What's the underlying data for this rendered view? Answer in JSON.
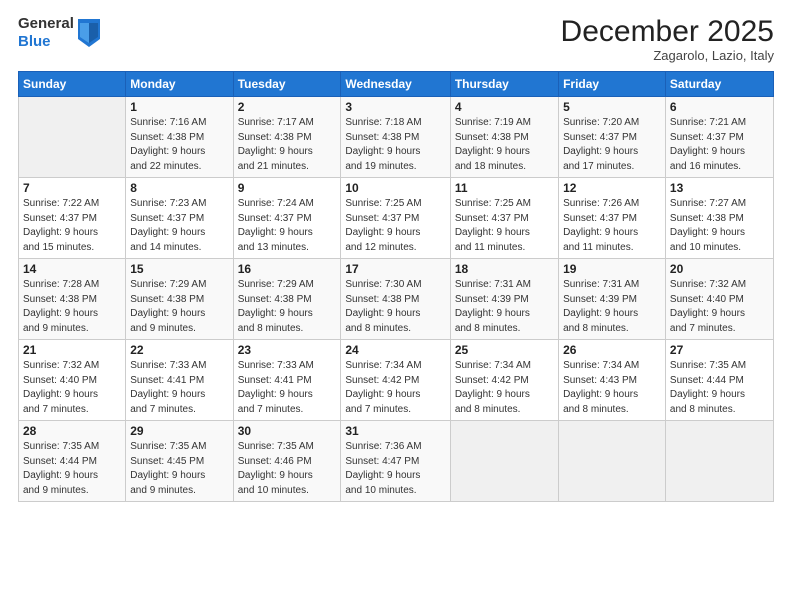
{
  "header": {
    "logo_line1": "General",
    "logo_line2": "Blue",
    "month": "December 2025",
    "location": "Zagarolo, Lazio, Italy"
  },
  "weekdays": [
    "Sunday",
    "Monday",
    "Tuesday",
    "Wednesday",
    "Thursday",
    "Friday",
    "Saturday"
  ],
  "weeks": [
    [
      {
        "day": "",
        "info": ""
      },
      {
        "day": "1",
        "info": "Sunrise: 7:16 AM\nSunset: 4:38 PM\nDaylight: 9 hours\nand 22 minutes."
      },
      {
        "day": "2",
        "info": "Sunrise: 7:17 AM\nSunset: 4:38 PM\nDaylight: 9 hours\nand 21 minutes."
      },
      {
        "day": "3",
        "info": "Sunrise: 7:18 AM\nSunset: 4:38 PM\nDaylight: 9 hours\nand 19 minutes."
      },
      {
        "day": "4",
        "info": "Sunrise: 7:19 AM\nSunset: 4:38 PM\nDaylight: 9 hours\nand 18 minutes."
      },
      {
        "day": "5",
        "info": "Sunrise: 7:20 AM\nSunset: 4:37 PM\nDaylight: 9 hours\nand 17 minutes."
      },
      {
        "day": "6",
        "info": "Sunrise: 7:21 AM\nSunset: 4:37 PM\nDaylight: 9 hours\nand 16 minutes."
      }
    ],
    [
      {
        "day": "7",
        "info": "Sunrise: 7:22 AM\nSunset: 4:37 PM\nDaylight: 9 hours\nand 15 minutes."
      },
      {
        "day": "8",
        "info": "Sunrise: 7:23 AM\nSunset: 4:37 PM\nDaylight: 9 hours\nand 14 minutes."
      },
      {
        "day": "9",
        "info": "Sunrise: 7:24 AM\nSunset: 4:37 PM\nDaylight: 9 hours\nand 13 minutes."
      },
      {
        "day": "10",
        "info": "Sunrise: 7:25 AM\nSunset: 4:37 PM\nDaylight: 9 hours\nand 12 minutes."
      },
      {
        "day": "11",
        "info": "Sunrise: 7:25 AM\nSunset: 4:37 PM\nDaylight: 9 hours\nand 11 minutes."
      },
      {
        "day": "12",
        "info": "Sunrise: 7:26 AM\nSunset: 4:37 PM\nDaylight: 9 hours\nand 11 minutes."
      },
      {
        "day": "13",
        "info": "Sunrise: 7:27 AM\nSunset: 4:38 PM\nDaylight: 9 hours\nand 10 minutes."
      }
    ],
    [
      {
        "day": "14",
        "info": "Sunrise: 7:28 AM\nSunset: 4:38 PM\nDaylight: 9 hours\nand 9 minutes."
      },
      {
        "day": "15",
        "info": "Sunrise: 7:29 AM\nSunset: 4:38 PM\nDaylight: 9 hours\nand 9 minutes."
      },
      {
        "day": "16",
        "info": "Sunrise: 7:29 AM\nSunset: 4:38 PM\nDaylight: 9 hours\nand 8 minutes."
      },
      {
        "day": "17",
        "info": "Sunrise: 7:30 AM\nSunset: 4:38 PM\nDaylight: 9 hours\nand 8 minutes."
      },
      {
        "day": "18",
        "info": "Sunrise: 7:31 AM\nSunset: 4:39 PM\nDaylight: 9 hours\nand 8 minutes."
      },
      {
        "day": "19",
        "info": "Sunrise: 7:31 AM\nSunset: 4:39 PM\nDaylight: 9 hours\nand 8 minutes."
      },
      {
        "day": "20",
        "info": "Sunrise: 7:32 AM\nSunset: 4:40 PM\nDaylight: 9 hours\nand 7 minutes."
      }
    ],
    [
      {
        "day": "21",
        "info": "Sunrise: 7:32 AM\nSunset: 4:40 PM\nDaylight: 9 hours\nand 7 minutes."
      },
      {
        "day": "22",
        "info": "Sunrise: 7:33 AM\nSunset: 4:41 PM\nDaylight: 9 hours\nand 7 minutes."
      },
      {
        "day": "23",
        "info": "Sunrise: 7:33 AM\nSunset: 4:41 PM\nDaylight: 9 hours\nand 7 minutes."
      },
      {
        "day": "24",
        "info": "Sunrise: 7:34 AM\nSunset: 4:42 PM\nDaylight: 9 hours\nand 7 minutes."
      },
      {
        "day": "25",
        "info": "Sunrise: 7:34 AM\nSunset: 4:42 PM\nDaylight: 9 hours\nand 8 minutes."
      },
      {
        "day": "26",
        "info": "Sunrise: 7:34 AM\nSunset: 4:43 PM\nDaylight: 9 hours\nand 8 minutes."
      },
      {
        "day": "27",
        "info": "Sunrise: 7:35 AM\nSunset: 4:44 PM\nDaylight: 9 hours\nand 8 minutes."
      }
    ],
    [
      {
        "day": "28",
        "info": "Sunrise: 7:35 AM\nSunset: 4:44 PM\nDaylight: 9 hours\nand 9 minutes."
      },
      {
        "day": "29",
        "info": "Sunrise: 7:35 AM\nSunset: 4:45 PM\nDaylight: 9 hours\nand 9 minutes."
      },
      {
        "day": "30",
        "info": "Sunrise: 7:35 AM\nSunset: 4:46 PM\nDaylight: 9 hours\nand 10 minutes."
      },
      {
        "day": "31",
        "info": "Sunrise: 7:36 AM\nSunset: 4:47 PM\nDaylight: 9 hours\nand 10 minutes."
      },
      {
        "day": "",
        "info": ""
      },
      {
        "day": "",
        "info": ""
      },
      {
        "day": "",
        "info": ""
      }
    ]
  ]
}
